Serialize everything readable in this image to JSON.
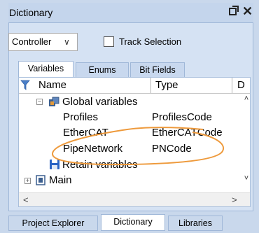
{
  "window": {
    "title": "Dictionary",
    "pin_glyph": "❐",
    "close_glyph": "✕"
  },
  "toolbar": {
    "controller_label": "Controller",
    "controller_chevron": "∨",
    "track_selection_label": "Track Selection",
    "track_selection_checked": false
  },
  "tabs": [
    {
      "label": "Variables",
      "active": true
    },
    {
      "label": "Enums",
      "active": false
    },
    {
      "label": "Bit Fields",
      "active": false
    }
  ],
  "grid": {
    "columns": [
      "Name",
      "Type",
      "D"
    ],
    "rows": {
      "global": {
        "expander": "−",
        "name": "Global variables"
      },
      "profiles": {
        "name": "Profiles",
        "type": "ProfilesCode"
      },
      "ethercat": {
        "name": "EtherCAT",
        "type": "EtherCATCode"
      },
      "pipenetwork": {
        "name": "PipeNetwork",
        "type": "PNCode"
      },
      "retain": {
        "name": "Retain variables"
      },
      "main": {
        "expander": "+",
        "name": "Main"
      }
    },
    "scroll": {
      "up": "˄",
      "down": "˅",
      "left": "<",
      "right": ">"
    }
  },
  "bottom_tabs": [
    {
      "label": "Project Explorer",
      "active": false
    },
    {
      "label": "Dictionary",
      "active": true
    },
    {
      "label": "Libraries",
      "active": false
    }
  ],
  "colors": {
    "highlight_ellipse": "#ee9a3c",
    "filter_icon": "#4a7fc8"
  }
}
